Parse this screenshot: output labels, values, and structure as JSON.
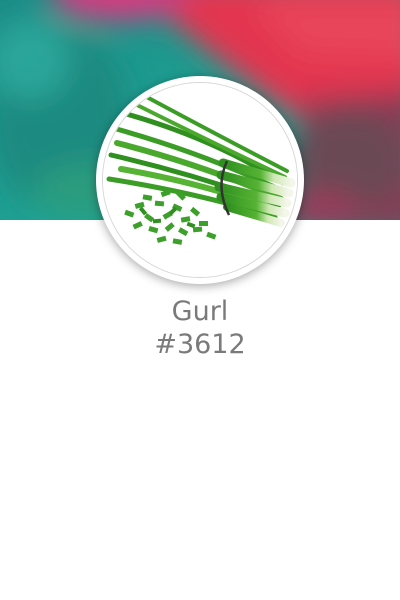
{
  "profile": {
    "name": "Gurl",
    "number": "#3612",
    "avatar_icon": "green-onion-image",
    "cover_icon": "blurred-cover-image"
  },
  "colors": {
    "cover_teal": "#1f8f8a",
    "cover_red": "#e0344d",
    "text_gray": "#7a7a7a",
    "onion_green": "#3da02a"
  }
}
